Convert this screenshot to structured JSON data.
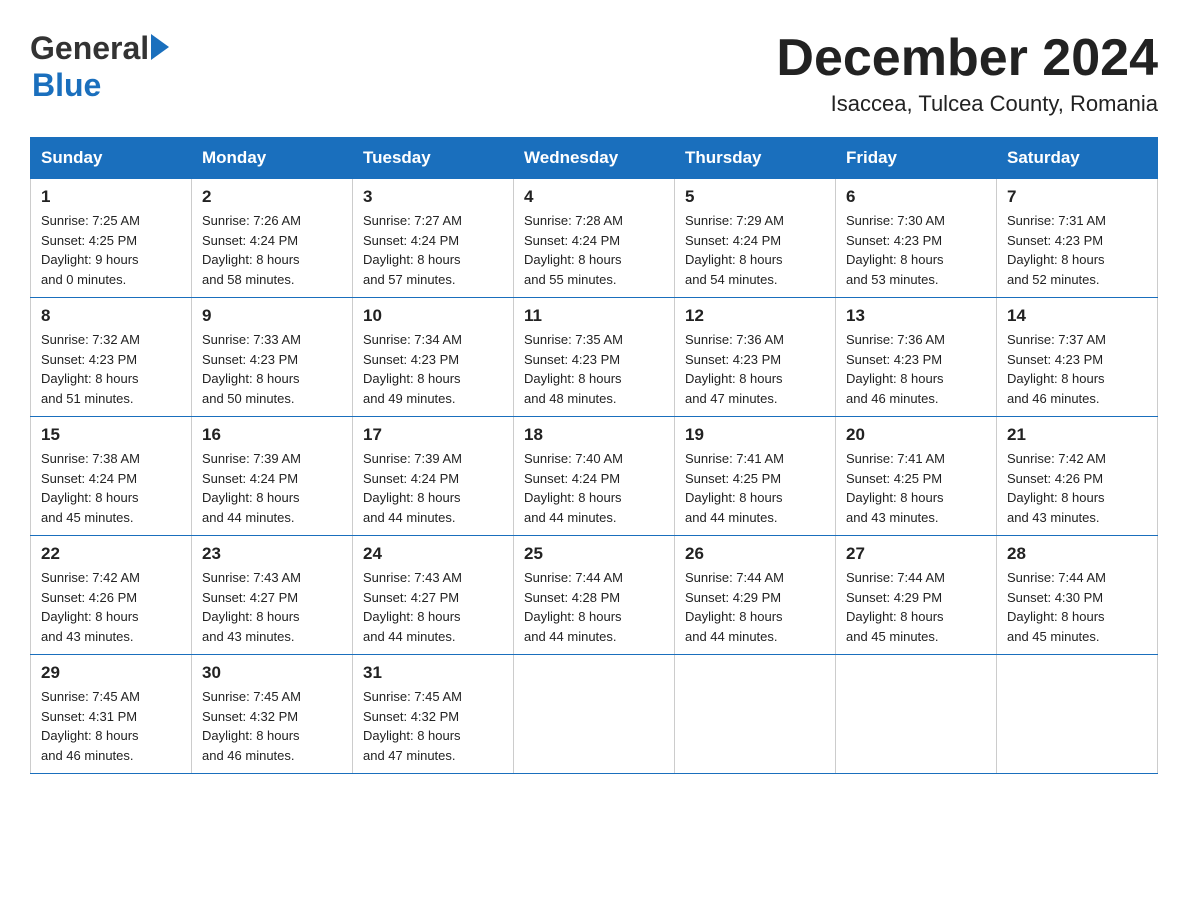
{
  "header": {
    "logo_text1": "General",
    "logo_text2": "Blue",
    "month_title": "December 2024",
    "location": "Isaccea, Tulcea County, Romania"
  },
  "days_of_week": [
    "Sunday",
    "Monday",
    "Tuesday",
    "Wednesday",
    "Thursday",
    "Friday",
    "Saturday"
  ],
  "weeks": [
    [
      {
        "day": "1",
        "sunrise": "7:25 AM",
        "sunset": "4:25 PM",
        "daylight_hours": "9",
        "daylight_minutes": "0"
      },
      {
        "day": "2",
        "sunrise": "7:26 AM",
        "sunset": "4:24 PM",
        "daylight_hours": "8",
        "daylight_minutes": "58"
      },
      {
        "day": "3",
        "sunrise": "7:27 AM",
        "sunset": "4:24 PM",
        "daylight_hours": "8",
        "daylight_minutes": "57"
      },
      {
        "day": "4",
        "sunrise": "7:28 AM",
        "sunset": "4:24 PM",
        "daylight_hours": "8",
        "daylight_minutes": "55"
      },
      {
        "day": "5",
        "sunrise": "7:29 AM",
        "sunset": "4:24 PM",
        "daylight_hours": "8",
        "daylight_minutes": "54"
      },
      {
        "day": "6",
        "sunrise": "7:30 AM",
        "sunset": "4:23 PM",
        "daylight_hours": "8",
        "daylight_minutes": "53"
      },
      {
        "day": "7",
        "sunrise": "7:31 AM",
        "sunset": "4:23 PM",
        "daylight_hours": "8",
        "daylight_minutes": "52"
      }
    ],
    [
      {
        "day": "8",
        "sunrise": "7:32 AM",
        "sunset": "4:23 PM",
        "daylight_hours": "8",
        "daylight_minutes": "51"
      },
      {
        "day": "9",
        "sunrise": "7:33 AM",
        "sunset": "4:23 PM",
        "daylight_hours": "8",
        "daylight_minutes": "50"
      },
      {
        "day": "10",
        "sunrise": "7:34 AM",
        "sunset": "4:23 PM",
        "daylight_hours": "8",
        "daylight_minutes": "49"
      },
      {
        "day": "11",
        "sunrise": "7:35 AM",
        "sunset": "4:23 PM",
        "daylight_hours": "8",
        "daylight_minutes": "48"
      },
      {
        "day": "12",
        "sunrise": "7:36 AM",
        "sunset": "4:23 PM",
        "daylight_hours": "8",
        "daylight_minutes": "47"
      },
      {
        "day": "13",
        "sunrise": "7:36 AM",
        "sunset": "4:23 PM",
        "daylight_hours": "8",
        "daylight_minutes": "46"
      },
      {
        "day": "14",
        "sunrise": "7:37 AM",
        "sunset": "4:23 PM",
        "daylight_hours": "8",
        "daylight_minutes": "46"
      }
    ],
    [
      {
        "day": "15",
        "sunrise": "7:38 AM",
        "sunset": "4:24 PM",
        "daylight_hours": "8",
        "daylight_minutes": "45"
      },
      {
        "day": "16",
        "sunrise": "7:39 AM",
        "sunset": "4:24 PM",
        "daylight_hours": "8",
        "daylight_minutes": "44"
      },
      {
        "day": "17",
        "sunrise": "7:39 AM",
        "sunset": "4:24 PM",
        "daylight_hours": "8",
        "daylight_minutes": "44"
      },
      {
        "day": "18",
        "sunrise": "7:40 AM",
        "sunset": "4:24 PM",
        "daylight_hours": "8",
        "daylight_minutes": "44"
      },
      {
        "day": "19",
        "sunrise": "7:41 AM",
        "sunset": "4:25 PM",
        "daylight_hours": "8",
        "daylight_minutes": "44"
      },
      {
        "day": "20",
        "sunrise": "7:41 AM",
        "sunset": "4:25 PM",
        "daylight_hours": "8",
        "daylight_minutes": "43"
      },
      {
        "day": "21",
        "sunrise": "7:42 AM",
        "sunset": "4:26 PM",
        "daylight_hours": "8",
        "daylight_minutes": "43"
      }
    ],
    [
      {
        "day": "22",
        "sunrise": "7:42 AM",
        "sunset": "4:26 PM",
        "daylight_hours": "8",
        "daylight_minutes": "43"
      },
      {
        "day": "23",
        "sunrise": "7:43 AM",
        "sunset": "4:27 PM",
        "daylight_hours": "8",
        "daylight_minutes": "43"
      },
      {
        "day": "24",
        "sunrise": "7:43 AM",
        "sunset": "4:27 PM",
        "daylight_hours": "8",
        "daylight_minutes": "44"
      },
      {
        "day": "25",
        "sunrise": "7:44 AM",
        "sunset": "4:28 PM",
        "daylight_hours": "8",
        "daylight_minutes": "44"
      },
      {
        "day": "26",
        "sunrise": "7:44 AM",
        "sunset": "4:29 PM",
        "daylight_hours": "8",
        "daylight_minutes": "44"
      },
      {
        "day": "27",
        "sunrise": "7:44 AM",
        "sunset": "4:29 PM",
        "daylight_hours": "8",
        "daylight_minutes": "45"
      },
      {
        "day": "28",
        "sunrise": "7:44 AM",
        "sunset": "4:30 PM",
        "daylight_hours": "8",
        "daylight_minutes": "45"
      }
    ],
    [
      {
        "day": "29",
        "sunrise": "7:45 AM",
        "sunset": "4:31 PM",
        "daylight_hours": "8",
        "daylight_minutes": "46"
      },
      {
        "day": "30",
        "sunrise": "7:45 AM",
        "sunset": "4:32 PM",
        "daylight_hours": "8",
        "daylight_minutes": "46"
      },
      {
        "day": "31",
        "sunrise": "7:45 AM",
        "sunset": "4:32 PM",
        "daylight_hours": "8",
        "daylight_minutes": "47"
      },
      null,
      null,
      null,
      null
    ]
  ],
  "labels": {
    "sunrise": "Sunrise:",
    "sunset": "Sunset:",
    "daylight": "Daylight:",
    "hours_suffix": "hours",
    "and": "and",
    "minutes_suffix": "minutes."
  }
}
